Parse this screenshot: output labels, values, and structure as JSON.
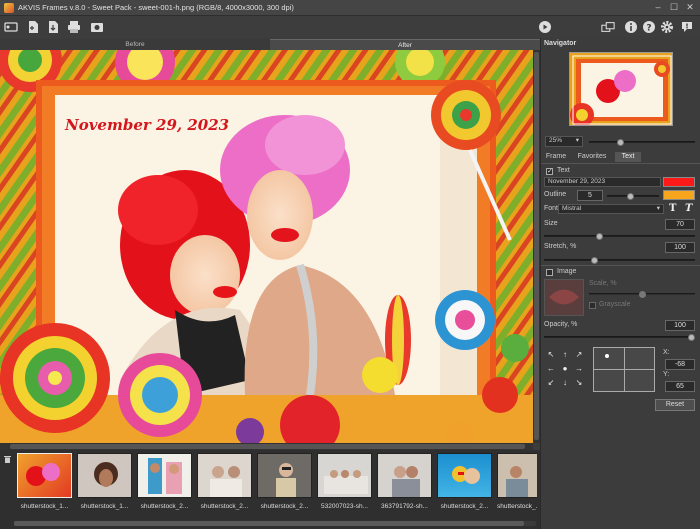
{
  "window": {
    "title": "AKVIS Frames v.8.0 - Sweet Pack - sweet-001-h.png (RGB/8, 4000x3000, 300 dpi)"
  },
  "tabs": {
    "before": "Before",
    "after": "After"
  },
  "canvas": {
    "date_text": "November 29, 2023"
  },
  "navigator": {
    "title": "Navigator",
    "zoom": "25%"
  },
  "panel_tabs": [
    "Frame",
    "Favorites",
    "Text"
  ],
  "text_settings": {
    "text_label": "Text",
    "text_value": "November 29, 2023",
    "text_color": "#ff1a1a",
    "outline_label": "Outline",
    "outline_value": "5",
    "outline_color": "#f6a51c",
    "font_label": "Font",
    "font_value": "Mistral",
    "size_label": "Size",
    "size_value": "70",
    "stretch_label": "Stretch, %",
    "stretch_value": "100",
    "image_label": "Image",
    "scale_label": "Scale, %",
    "grayscale_label": "Grayscale",
    "opacity_label": "Opacity, %",
    "opacity_value": "100",
    "x_label": "X:",
    "x_value": "-68",
    "y_label": "Y:",
    "y_value": "65",
    "reset_label": "Reset"
  },
  "filmstrip": [
    {
      "caption": "shutterstock_1..."
    },
    {
      "caption": "shutterstock_1..."
    },
    {
      "caption": "shutterstock_2..."
    },
    {
      "caption": "shutterstock_2..."
    },
    {
      "caption": "shutterstock_2..."
    },
    {
      "caption": "532007023-sh..."
    },
    {
      "caption": "363791792-sh..."
    },
    {
      "caption": "shutterstock_2..."
    },
    {
      "caption": "shutterstock_..."
    }
  ]
}
